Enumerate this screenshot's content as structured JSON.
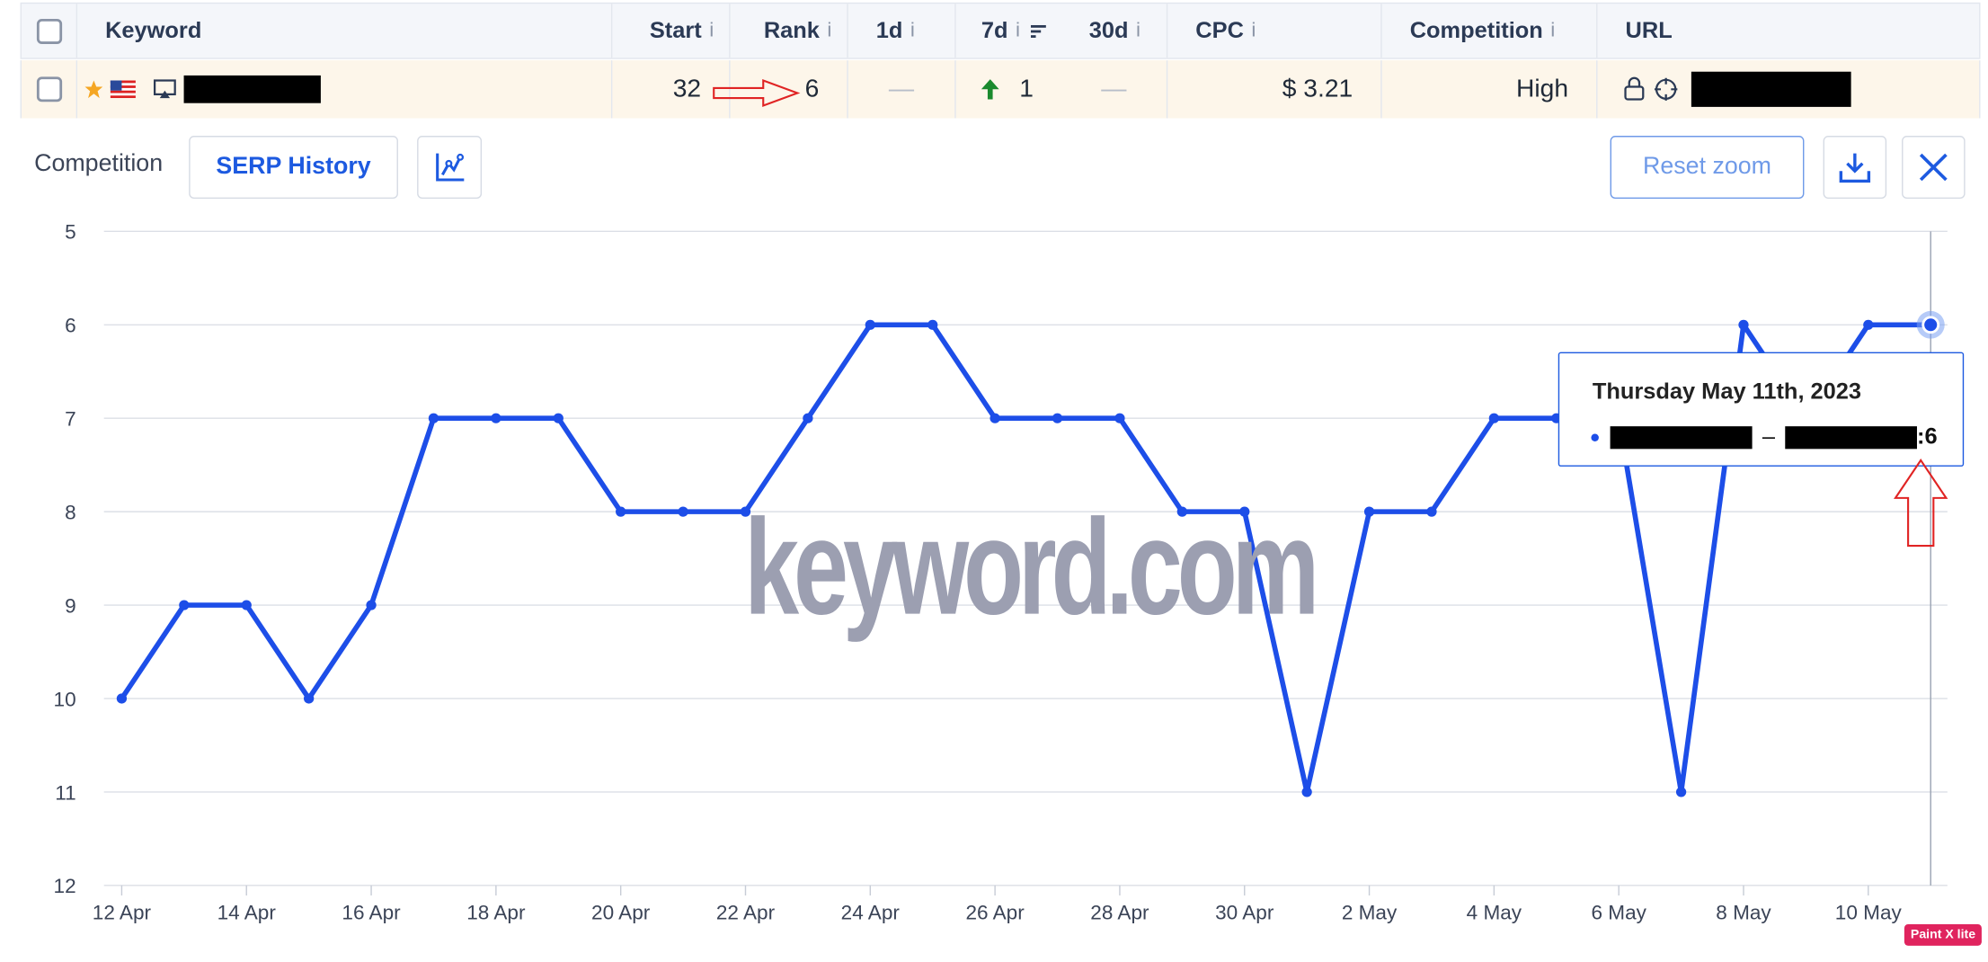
{
  "table": {
    "headers": {
      "keyword": "Keyword",
      "start": "Start",
      "rank": "Rank",
      "d1": "1d",
      "d7": "7d",
      "d30": "30d",
      "cpc": "CPC",
      "competition": "Competition",
      "url": "URL",
      "info": "i"
    },
    "row": {
      "start": "32",
      "rank": "6",
      "d1": "—",
      "d7": "1",
      "d30": "—",
      "cpc": "$ 3.21",
      "competition": "High"
    }
  },
  "toolbar": {
    "label": "Competition",
    "serp_history": "SERP History",
    "reset_zoom": "Reset zoom"
  },
  "colors": {
    "line": "#1d4ee8",
    "accent": "#1d5ae0",
    "up_arrow": "#1a8a2e",
    "annotation": "#e02424",
    "star": "#f5a623"
  },
  "watermark": "keyword.com",
  "tooltip": {
    "date": "Thursday May 11th, 2023",
    "separator": "–",
    "value": ":6"
  },
  "chart_data": {
    "type": "line",
    "x_ticks": [
      "12 Apr",
      "14 Apr",
      "16 Apr",
      "18 Apr",
      "20 Apr",
      "22 Apr",
      "24 Apr",
      "26 Apr",
      "28 Apr",
      "30 Apr",
      "2 May",
      "4 May",
      "6 May",
      "8 May",
      "10 May"
    ],
    "y_ticks": [
      "5",
      "6",
      "7",
      "8",
      "9",
      "10",
      "11",
      "12"
    ],
    "ylim": [
      5,
      12
    ],
    "y_inverted": true,
    "grid": true,
    "series": [
      {
        "x": [
          "12 Apr",
          "13 Apr",
          "14 Apr",
          "15 Apr",
          "16 Apr",
          "17 Apr",
          "18 Apr",
          "19 Apr",
          "20 Apr",
          "21 Apr",
          "22 Apr",
          "23 Apr",
          "24 Apr",
          "25 Apr",
          "26 Apr",
          "27 Apr",
          "28 Apr",
          "29 Apr",
          "30 Apr",
          "1 May",
          "2 May",
          "3 May",
          "4 May",
          "5 May",
          "6 May",
          "7 May",
          "8 May",
          "9 May",
          "10 May",
          "11 May"
        ],
        "values": [
          10,
          9,
          9,
          10,
          9,
          7,
          7,
          7,
          8,
          8,
          8,
          7,
          6,
          6,
          7,
          7,
          7,
          8,
          8,
          11,
          8,
          8,
          7,
          7,
          7,
          11,
          6,
          7,
          6,
          6
        ]
      }
    ]
  },
  "badge": "Paint X lite"
}
